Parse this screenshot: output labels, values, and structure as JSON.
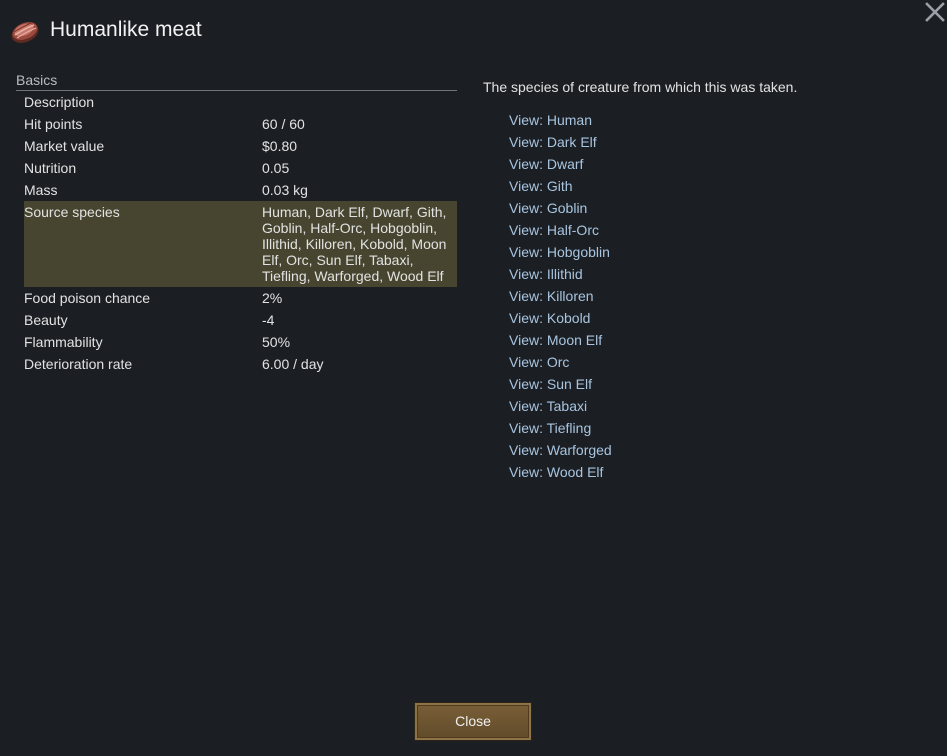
{
  "window": {
    "title": "Humanlike meat",
    "icon": "meat-icon",
    "close_icon": "close-x-icon"
  },
  "basics": {
    "section_label": "Basics",
    "rows": [
      {
        "name": "description",
        "label": "Description",
        "value": ""
      },
      {
        "name": "hit-points",
        "label": "Hit points",
        "value": "60 / 60"
      },
      {
        "name": "market-value",
        "label": "Market value",
        "value": "$0.80"
      },
      {
        "name": "nutrition",
        "label": "Nutrition",
        "value": "0.05"
      },
      {
        "name": "mass",
        "label": "Mass",
        "value": "0.03 kg"
      },
      {
        "name": "source-species",
        "label": "Source species",
        "value": "Human, Dark Elf, Dwarf, Gith, Goblin, Half-Orc, Hobgoblin, Illithid, Killoren, Kobold, Moon Elf, Orc, Sun Elf, Tabaxi, Tiefling, Warforged, Wood Elf",
        "highlighted": true
      },
      {
        "name": "food-poison-chance",
        "label": "Food poison chance",
        "value": "2%"
      },
      {
        "name": "beauty",
        "label": "Beauty",
        "value": "-4"
      },
      {
        "name": "flammability",
        "label": "Flammability",
        "value": "50%"
      },
      {
        "name": "deterioration-rate",
        "label": "Deterioration rate",
        "value": "6.00 / day"
      }
    ]
  },
  "detail": {
    "description": "The species of creature from which this was taken.",
    "links": [
      "View: Human",
      "View: Dark Elf",
      "View: Dwarf",
      "View: Gith",
      "View: Goblin",
      "View: Half-Orc",
      "View: Hobgoblin",
      "View: Illithid",
      "View: Killoren",
      "View: Kobold",
      "View: Moon Elf",
      "View: Orc",
      "View: Sun Elf",
      "View: Tabaxi",
      "View: Tiefling",
      "View: Warforged",
      "View: Wood Elf"
    ]
  },
  "footer": {
    "close_label": "Close"
  },
  "colors": {
    "background": "#1b1f24",
    "highlight": "#47452f",
    "link": "#a8c4df",
    "button": "#6e5532"
  }
}
